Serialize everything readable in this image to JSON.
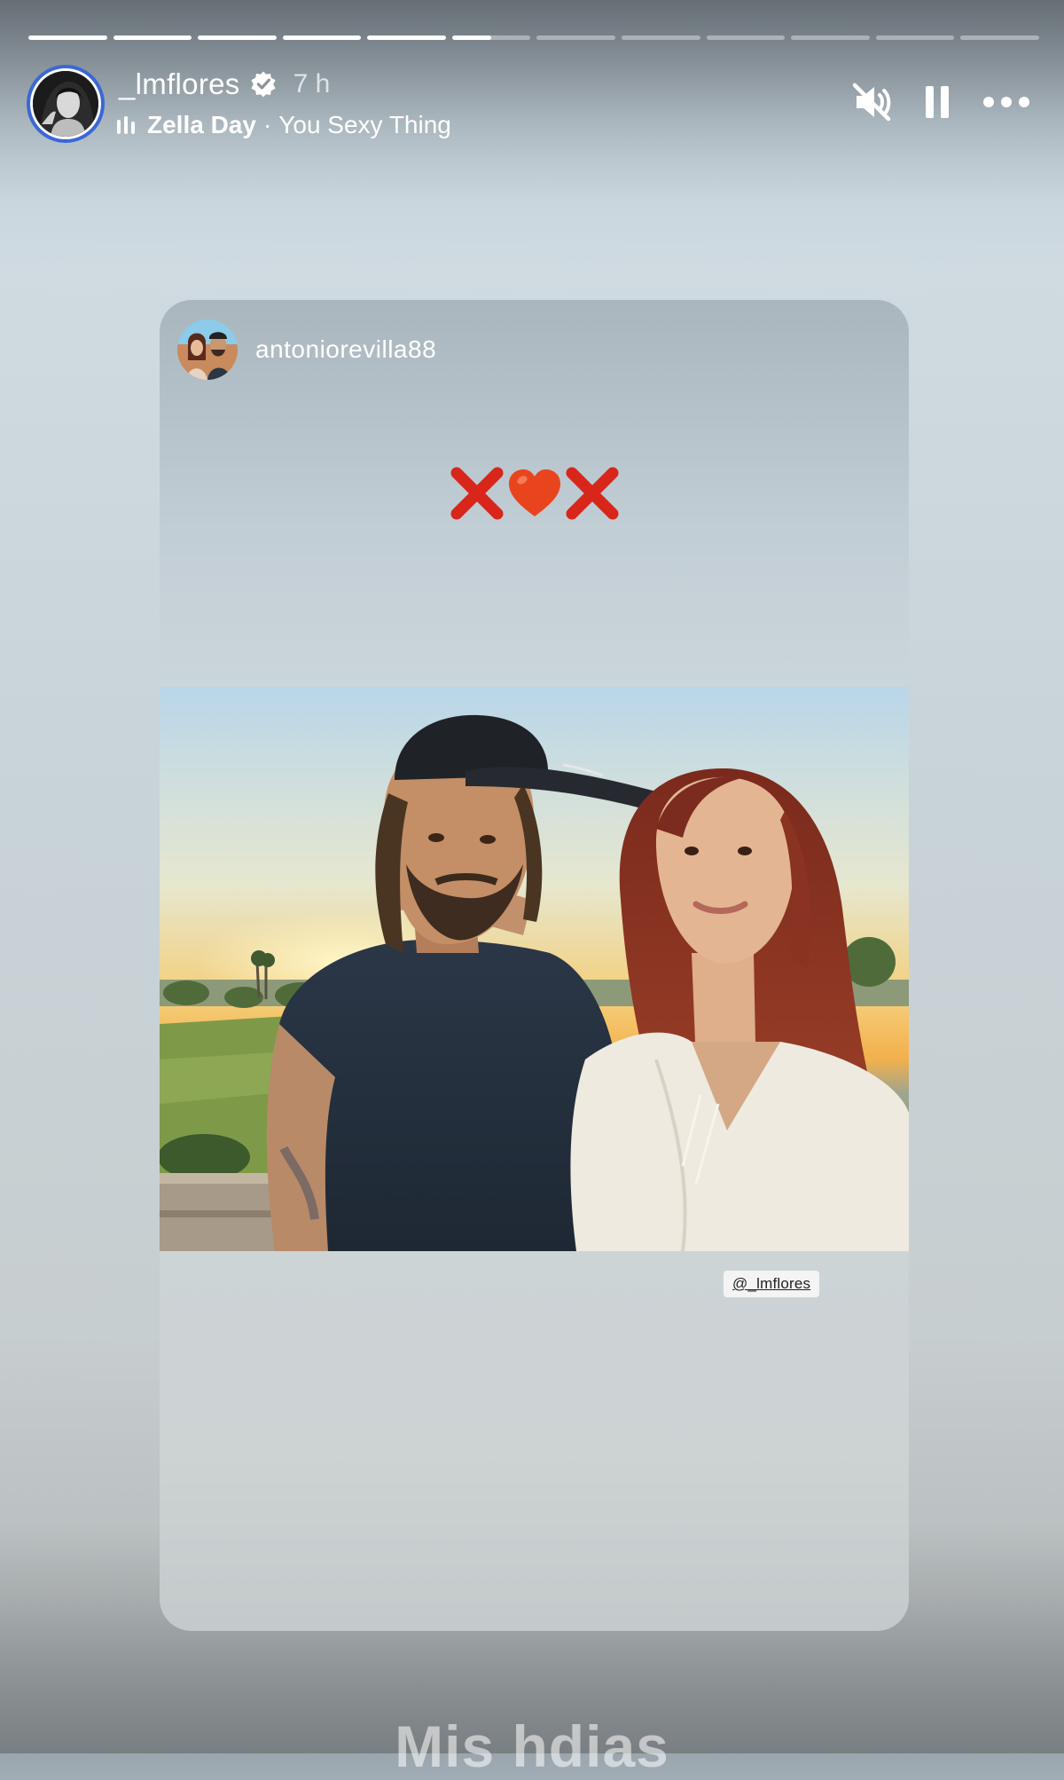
{
  "story": {
    "progress_segments": [
      {
        "fill": 1
      },
      {
        "fill": 1
      },
      {
        "fill": 1
      },
      {
        "fill": 1
      },
      {
        "fill": 1
      },
      {
        "fill": 0.5
      },
      {
        "fill": 0
      },
      {
        "fill": 0
      },
      {
        "fill": 0
      },
      {
        "fill": 0
      },
      {
        "fill": 0
      },
      {
        "fill": 0
      }
    ]
  },
  "header": {
    "username": "_lmflores",
    "verified": true,
    "time": "7 h",
    "music": {
      "artist": "Zella Day",
      "separator": "·",
      "song": "You Sexy Thing"
    },
    "icons": {
      "mute": "speaker-muted-icon",
      "pause": "pause-icon",
      "more": "more-options-icon"
    }
  },
  "shared_post": {
    "username": "antoniorevilla88",
    "sticker_emojis": "❌❤️❌",
    "mention": "@_lmflores"
  },
  "caption": {
    "text": "Mis hdias"
  },
  "colors": {
    "ring": "#3b67d6",
    "heart": "#e8451e",
    "cross": "#d8261b"
  }
}
